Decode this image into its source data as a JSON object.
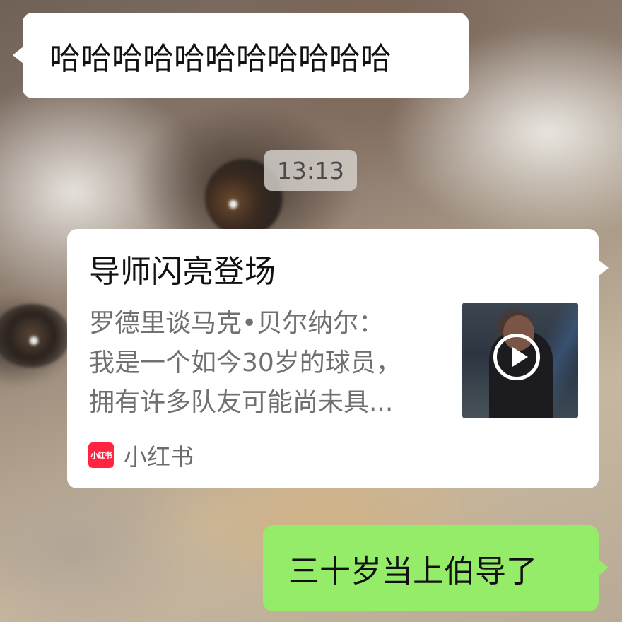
{
  "messages": {
    "incoming_1": "哈哈哈哈哈哈哈哈哈哈哈",
    "timestamp": "13:13",
    "share_card": {
      "title": "导师闪亮登场",
      "description_lines": [
        "罗德里谈马克•贝尔纳尔：",
        "我是一个如今30岁的球员，",
        "拥有许多队友可能尚未具..."
      ],
      "thumbnail_icon": "play-icon",
      "source_logo_text": "小红书",
      "source_name": "小红书"
    },
    "outgoing_1": "三十岁当上伯导了"
  },
  "colors": {
    "outgoing_bubble": "#95ec69",
    "incoming_bubble": "#ffffff",
    "timestamp_bg": "#d7d2cd",
    "source_brand": "#ff2442"
  }
}
